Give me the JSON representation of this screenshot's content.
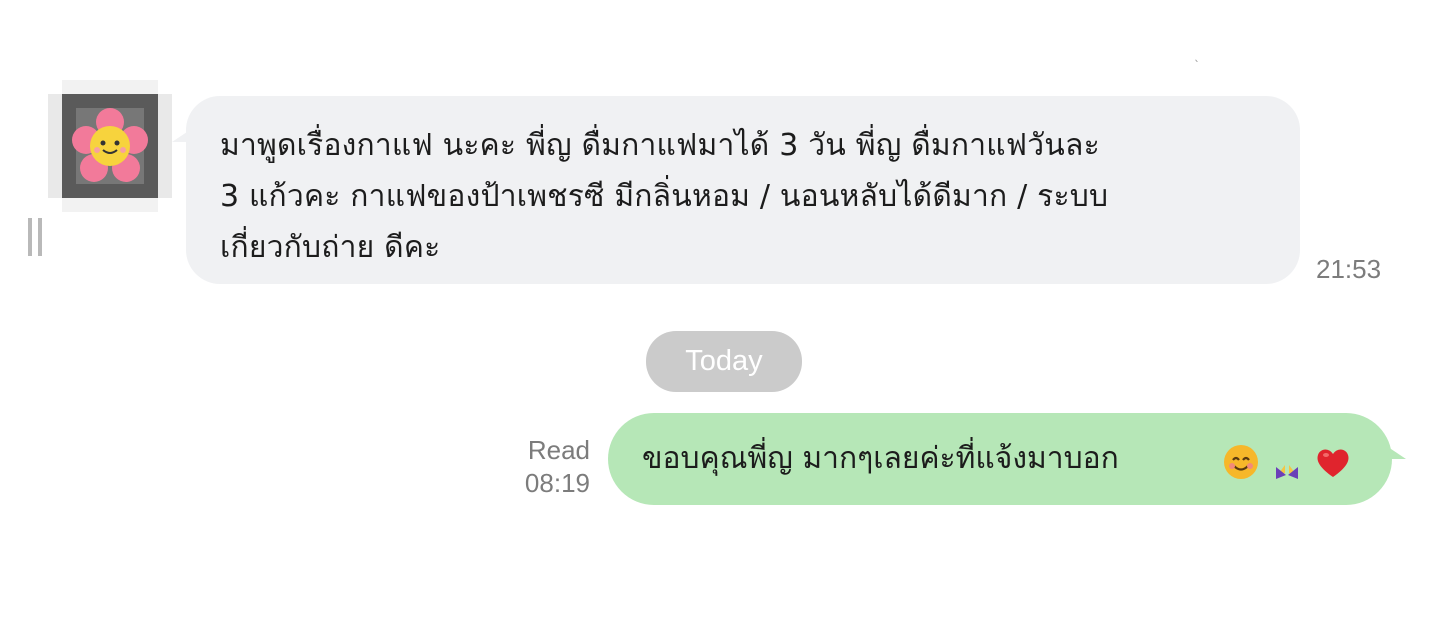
{
  "conversation": {
    "incoming": {
      "text_line1": "มาพูดเรื่องกาแฟ นะคะ พี่ญ ดื่มกาแฟมาได้ 3 วัน พี่ญ ดื่มกาแฟวันละ",
      "text_line2": "3 แก้วคะ กาแฟของป้าเพชรซี มีกลิ่นหอม / นอนหลับได้ดีมาก / ระบบ",
      "text_line3": "เกี่ยวกับถ่าย ดีคะ",
      "time": "21:53",
      "bubble_color": "#f0f1f3",
      "avatar_icon": "pixelated-flower-icon"
    },
    "date_separator": "Today",
    "outgoing": {
      "text": "ขอบคุณพี่ญ มากๆเลยค่ะที่แจ้งมาบอก",
      "emojis": [
        "smiling-face-icon",
        "praying-hands-icon",
        "red-heart-icon"
      ],
      "read_label": "Read",
      "time": "08:19",
      "bubble_color": "#b6e7b7"
    }
  }
}
